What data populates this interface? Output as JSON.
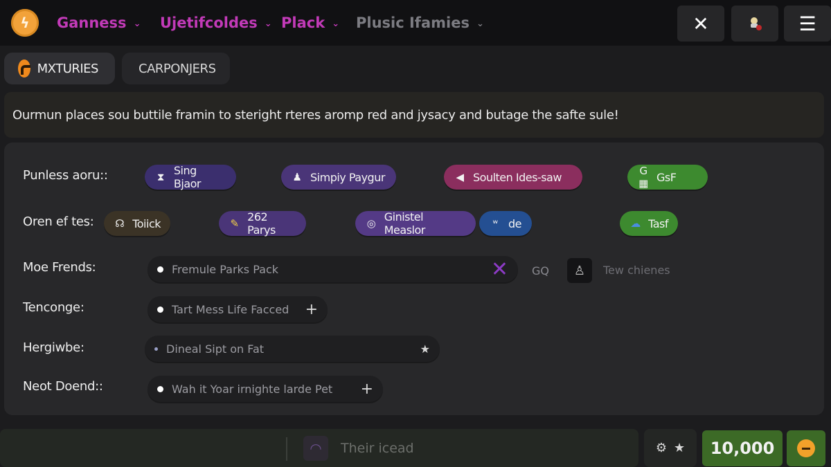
{
  "nav": {
    "items": [
      {
        "label": "Ganness"
      },
      {
        "label": "Ujetifcoldes"
      },
      {
        "label": "Plack"
      },
      {
        "label": "Plusic Ifamies"
      }
    ]
  },
  "tabs": [
    {
      "label": "MXTURIES"
    },
    {
      "label": "CARPONJERS"
    }
  ],
  "banner": {
    "text": "Ourmun places sou buttile framin to steright rteres aromp red and jysacy and butage the safte sule!"
  },
  "rows": {
    "row1": {
      "label": "Punless aoru::",
      "chips": [
        {
          "label": "Sing Bjaor",
          "icon": "hourglass-icon"
        },
        {
          "label": "Simpiy Paygur",
          "icon": "pawn-icon"
        },
        {
          "label": "Soulten Ides-saw",
          "icon": "megaphone-icon"
        },
        {
          "label": "GsF",
          "icon": "puzzle-icon"
        }
      ]
    },
    "row2": {
      "label": "Oren ef tes:",
      "chips": [
        {
          "label": "Toiick",
          "icon": "headset-icon"
        },
        {
          "label": "262 Parys",
          "icon": "ticket-icon"
        },
        {
          "label": "Ginistel Measlor",
          "icon": "camera-icon"
        },
        {
          "label": "de",
          "icon": "controller-icon"
        },
        {
          "label": "Tasf",
          "icon": "cloud-icon"
        }
      ]
    },
    "row3": {
      "label": "Moe Frends:",
      "field": "Fremule Parks Pack",
      "side_code": "GQ",
      "side_text": "Tew chienes"
    },
    "row4": {
      "label": "Tenconge:",
      "field": "Tart Mess Life Facced"
    },
    "row5": {
      "label": "Hergiwbe:",
      "field": "Dineal Sipt on Fat"
    },
    "row6": {
      "label": "Neot Doend::",
      "field": "Wah it Yoar irnighte larde Pet"
    }
  },
  "bottom": {
    "input_text": "Their icead",
    "count": "10,000"
  }
}
